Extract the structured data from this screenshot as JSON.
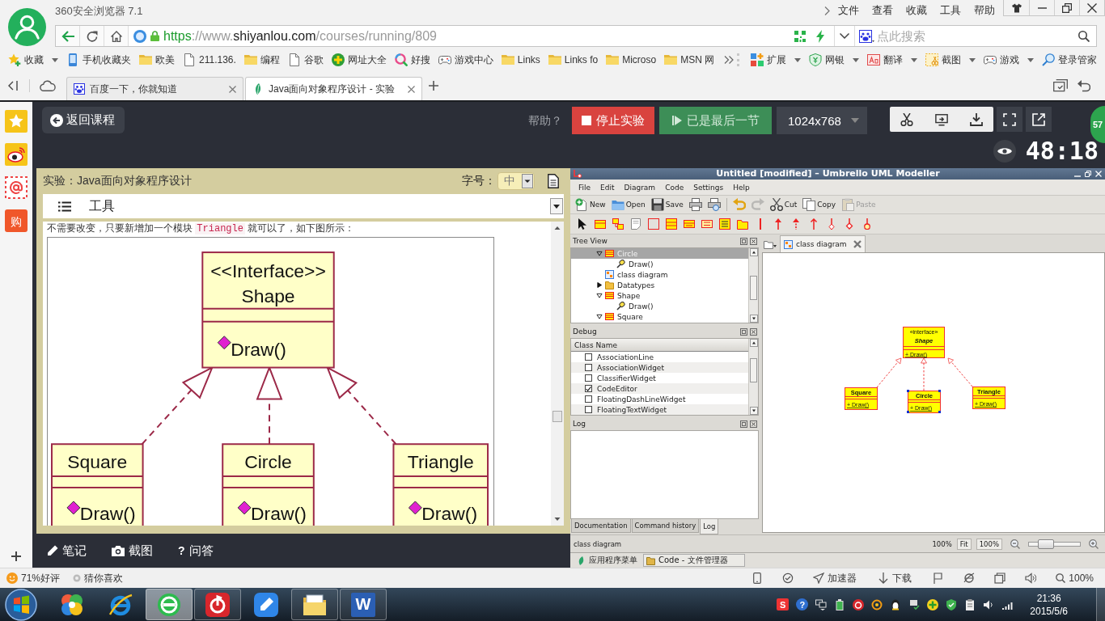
{
  "browser": {
    "title": "360安全浏览器 7.1",
    "menu": [
      "文件",
      "查看",
      "收藏",
      "工具",
      "帮助"
    ],
    "url": {
      "scheme": "https",
      "separator": "://www.",
      "domain": "shiyanlou.com",
      "path": "/courses/running/809"
    },
    "search": {
      "placeholder": "点此搜索"
    },
    "bookmarks": [
      {
        "label": "收藏",
        "kind": "star",
        "dropdown": true
      },
      {
        "label": "手机收藏夹",
        "kind": "phone",
        "dropdown": false
      },
      {
        "label": "欧美",
        "kind": "folder",
        "dropdown": false
      },
      {
        "label": "211.136.",
        "kind": "page",
        "dropdown": false
      },
      {
        "label": "编程",
        "kind": "folder",
        "dropdown": false
      },
      {
        "label": "谷歌",
        "kind": "page",
        "dropdown": false
      },
      {
        "label": "网址大全",
        "kind": "plus",
        "dropdown": false
      },
      {
        "label": "好搜",
        "kind": "search",
        "dropdown": false
      },
      {
        "label": "游戏中心",
        "kind": "gamepad",
        "dropdown": false
      },
      {
        "label": "Links",
        "kind": "folder",
        "dropdown": false
      },
      {
        "label": "Links fo",
        "kind": "folder",
        "dropdown": false
      },
      {
        "label": "Microso",
        "kind": "folder",
        "dropdown": false
      },
      {
        "label": "MSN 网",
        "kind": "folder",
        "dropdown": false
      }
    ],
    "extensions": [
      {
        "label": "扩展",
        "kind": "apps",
        "dropdown": true
      },
      {
        "label": "网银",
        "kind": "shield",
        "dropdown": true
      },
      {
        "label": "翻译",
        "kind": "translate",
        "dropdown": true
      },
      {
        "label": "截图",
        "kind": "scissors",
        "dropdown": true
      },
      {
        "label": "游戏",
        "kind": "gamepad",
        "dropdown": true
      },
      {
        "label": "登录管家",
        "kind": "key",
        "dropdown": false
      }
    ],
    "tabs": [
      {
        "label": "百度一下，你就知道",
        "kind": "paw",
        "selected": false
      },
      {
        "label": "Java面向对象程序设计 - 实验",
        "kind": "leaf",
        "selected": true
      }
    ]
  },
  "sidebar": {
    "shop_glyph": "购"
  },
  "lab": {
    "back": "返回课程",
    "help": "帮助？",
    "stop": "停止实验",
    "last": "已是最后一节",
    "resolution": "1024x768",
    "badge": "57",
    "timer": "48:18"
  },
  "doc": {
    "title": "实验：Java面向对象程序设计",
    "font_label": "字号：",
    "font_size": "中",
    "tools": "工具",
    "intro": {
      "before": "不需要改变，只要新增加一个模块",
      "code": "Triangle",
      "after": "就可以了，如下图所示："
    },
    "figure": {
      "stereotype": "<<Interface>>",
      "interface": "Shape",
      "interface_method": "Draw()",
      "classes": [
        {
          "name": "Square",
          "method": "Draw()"
        },
        {
          "name": "Circle",
          "method": "Draw()"
        },
        {
          "name": "Triangle",
          "method": "Draw()"
        }
      ]
    }
  },
  "notes_bar": [
    {
      "label": "笔记",
      "kind": "pencil"
    },
    {
      "label": "截图",
      "kind": "camera"
    },
    {
      "label": "问答",
      "kind": "question",
      "glyph": "?"
    }
  ],
  "umbrello": {
    "title": "Untitled [modified] – Umbrello UML Modeller",
    "menu": [
      "File",
      "Edit",
      "Diagram",
      "Code",
      "Settings",
      "Help"
    ],
    "toolbar": [
      {
        "label": "New",
        "kind": "new",
        "disabled": false
      },
      {
        "label": "Open",
        "kind": "open",
        "disabled": false
      },
      {
        "label": "Save",
        "kind": "save",
        "disabled": false
      },
      {
        "kind": "print",
        "disabled": false
      },
      {
        "kind": "preview",
        "disabled": false
      },
      {
        "kind": "undo",
        "disabled": false
      },
      {
        "kind": "redo",
        "disabled": true
      },
      {
        "label": "Cut",
        "kind": "cut",
        "disabled": false
      },
      {
        "label": "Copy",
        "kind": "copy",
        "disabled": false
      },
      {
        "label": "Paste",
        "kind": "paste",
        "disabled": true
      }
    ],
    "tree": {
      "title": "Tree View",
      "items": [
        {
          "label": "Circle",
          "kind": "class",
          "expanded": true,
          "selected": true,
          "children": [
            {
              "label": "Draw()",
              "kind": "operation",
              "selected": false
            }
          ]
        },
        {
          "label": "class diagram",
          "kind": "diagram",
          "selected": false
        },
        {
          "label": "Datatypes",
          "kind": "folder",
          "expanded": false,
          "selected": false
        },
        {
          "label": "Shape",
          "kind": "class",
          "expanded": true,
          "selected": false,
          "children": [
            {
              "label": "Draw()",
              "kind": "operation",
              "selected": false
            }
          ]
        },
        {
          "label": "Square",
          "kind": "class",
          "expanded": true,
          "selected": false
        }
      ]
    },
    "debug": {
      "title": "Debug",
      "column": "Class Name",
      "items": [
        {
          "label": "AssociationLine",
          "checked": false
        },
        {
          "label": "AssociationWidget",
          "checked": false
        },
        {
          "label": "ClassifierWidget",
          "checked": false
        },
        {
          "label": "CodeEditor",
          "checked": true
        },
        {
          "label": "FloatingDashLineWidget",
          "checked": false
        },
        {
          "label": "FloatingTextWidget",
          "checked": false
        }
      ]
    },
    "log": {
      "title": "Log"
    },
    "dock_tabs": [
      {
        "label": "Documentation",
        "selected": false
      },
      {
        "label": "Command history",
        "selected": false
      },
      {
        "label": "Log",
        "selected": true
      }
    ],
    "diagram_tabs": [
      {
        "label": "class diagram",
        "selected": true
      }
    ],
    "diagram": {
      "stereotype": "«interface»",
      "interface": "Shape",
      "interface_operation": "+ Draw()",
      "classes": [
        {
          "name": "Square",
          "operation": "+ Draw()",
          "selected": false
        },
        {
          "name": "Circle",
          "operation": "+ Draw()",
          "selected": true
        },
        {
          "name": "Triangle",
          "operation": "+ Draw()",
          "selected": false
        }
      ]
    },
    "status": {
      "text": "class diagram",
      "zoom": "100%",
      "fit": "Fit",
      "zoom_button": "100%",
      "slider": {
        "level": 0.25
      }
    },
    "taskbar": [
      {
        "label": "应用程序菜单",
        "kind": "menu"
      },
      {
        "label": "Code - 文件管理器",
        "kind": "folder"
      }
    ]
  },
  "status_bar": {
    "rating": "71%好评",
    "guess": "猜你喜欢",
    "accelerator": "加速器",
    "download": "下载",
    "zoom": "100%"
  },
  "taskbar": {
    "apps": [
      {
        "kind": "pinwheel",
        "open": false,
        "selected": false
      },
      {
        "kind": "ie",
        "open": false,
        "selected": false
      },
      {
        "kind": "browser",
        "open": true,
        "selected": true
      },
      {
        "kind": "music",
        "open": true,
        "selected": false
      },
      {
        "kind": "pen",
        "open": false,
        "selected": false
      },
      {
        "kind": "explorer",
        "open": true,
        "selected": false
      },
      {
        "kind": "word",
        "open": true,
        "selected": false,
        "glyph": "W"
      }
    ],
    "tray": [
      {
        "kind": "ime",
        "glyph": "S"
      },
      {
        "kind": "help",
        "glyph": "?"
      }
    ],
    "time": "21:36",
    "date": "2015/5/6"
  }
}
